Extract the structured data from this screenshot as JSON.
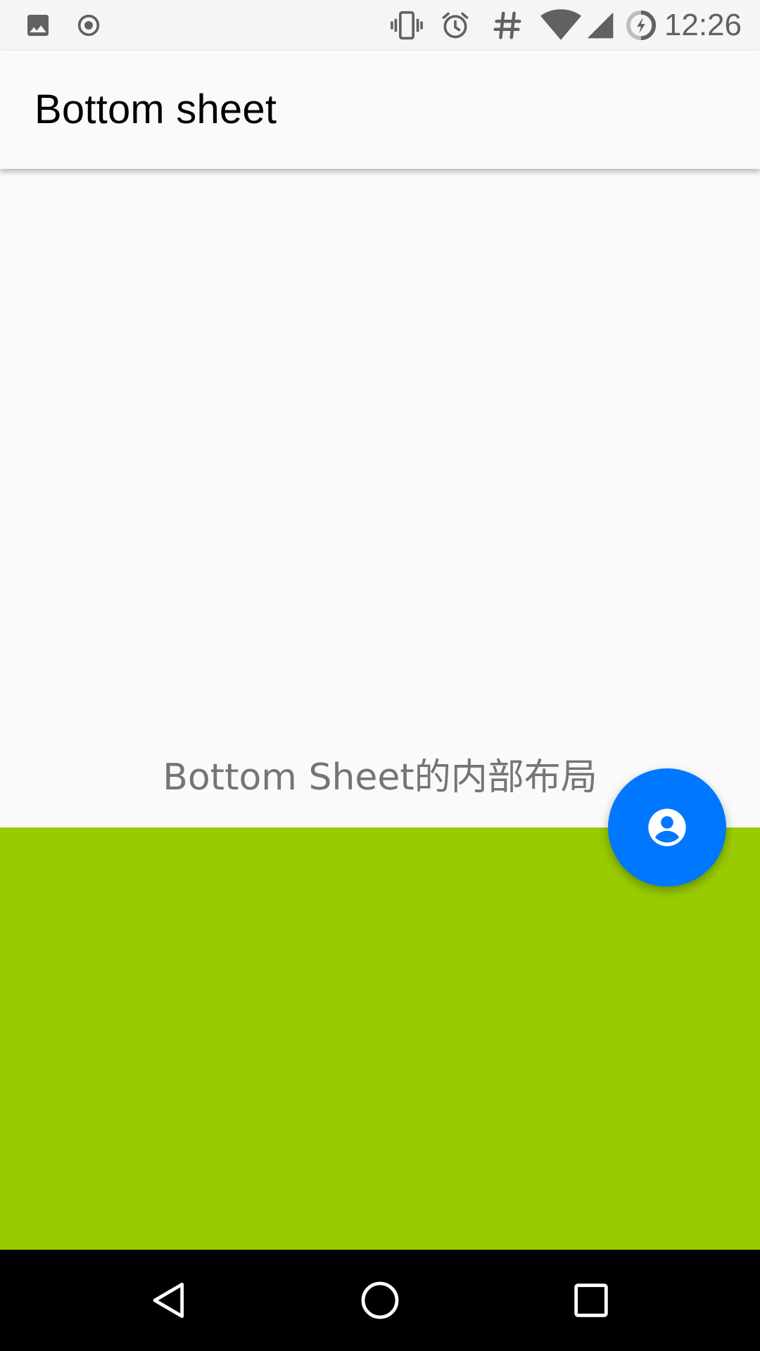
{
  "status_bar": {
    "time": "12:26",
    "left_icons": [
      "image-icon",
      "record-icon"
    ],
    "right_icons": [
      "vibrate-icon",
      "alarm-icon",
      "hash-icon",
      "wifi-icon",
      "cell-signal-icon",
      "battery-charging-icon"
    ]
  },
  "app_bar": {
    "title": "Bottom sheet"
  },
  "content": {
    "sheet_label": "Bottom Sheet的内部布局"
  },
  "bottom_sheet": {
    "color": "#99cc00"
  },
  "fab": {
    "icon": "account-circle-icon",
    "color": "#0077ff"
  },
  "nav_bar": {
    "buttons": [
      "back-icon",
      "home-icon",
      "recents-icon"
    ]
  }
}
